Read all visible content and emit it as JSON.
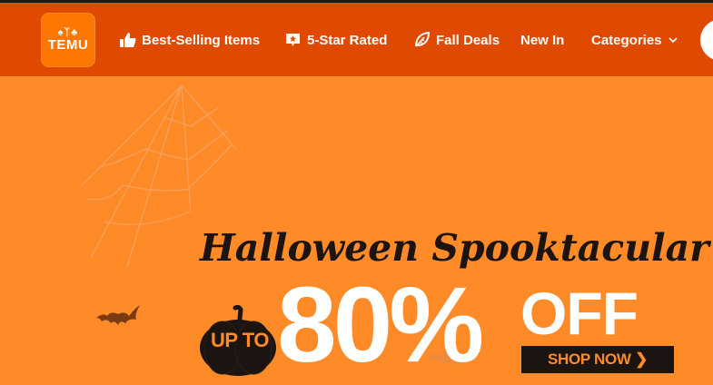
{
  "header": {
    "logo": {
      "glyphs": "♠ᛉ♣",
      "text": "TEMU"
    },
    "nav_items": [
      {
        "label": "Best-Selling Items",
        "icon": "thumbs-up-icon"
      },
      {
        "label": "5-Star Rated",
        "icon": "star-badge-icon"
      },
      {
        "label": "Fall Deals",
        "icon": "leaf-icon"
      },
      {
        "label": "New In"
      },
      {
        "label": "Categories",
        "icon": "chevron-down-icon"
      }
    ]
  },
  "banner": {
    "headline": "Halloween Spooktacular",
    "up_to": "UP TO",
    "discount": "80%",
    "off": "OFF",
    "cta": "SHOP NOW ❯"
  },
  "colors": {
    "header_bg": "#e04a00",
    "banner_bg": "#ff8a28",
    "logo_bg": "#fb7701",
    "headline_text": "#1c1410"
  }
}
